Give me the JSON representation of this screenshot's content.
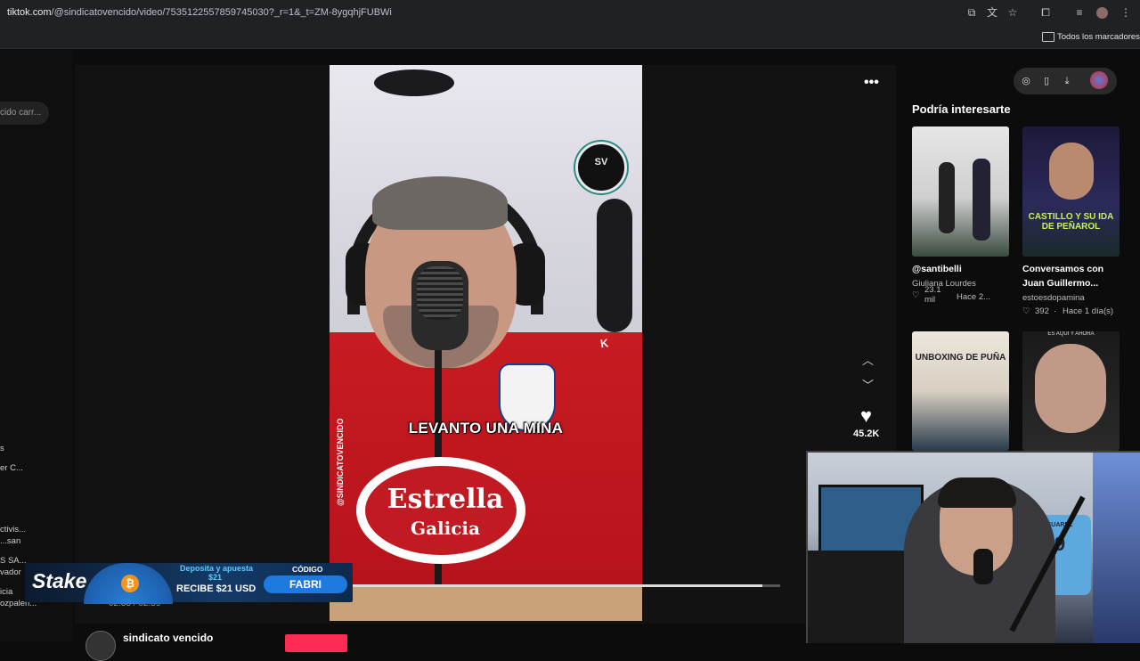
{
  "browser": {
    "url_host": "tiktok.com",
    "url_path": "/@sindicatovencido/video/7535122557859745030?_r=1&_t=ZM-8ygqhjFUBWi",
    "bookmarks_label": "Todos los marcadores"
  },
  "left_sidebar": {
    "search_text": "cido carr...",
    "items": [
      "s",
      "er C...",
      "ctivis...",
      "...san",
      "S SA...",
      "vador",
      "icia",
      "ozpalen..."
    ]
  },
  "video": {
    "overlay_caption": "LEVANTO UNA MINA",
    "watermark_handle": "@SINDICATOVENCIDO",
    "badge_text": "SV",
    "shirt_brand_1": "Estrella",
    "shirt_brand_2": "Galicia",
    "time": "02:33 / 02:59",
    "progress_fraction": 0.974
  },
  "actions": {
    "likes": "45.2K"
  },
  "account": {
    "name": "sindicato vencido"
  },
  "sidebar": {
    "title": "Podría interesarte",
    "recommendations": [
      {
        "title": "@santibelli",
        "author": "Giuliana Lourdes",
        "likes": "23.1 mil",
        "age": "Hace 2..."
      },
      {
        "title": "Conversamos con",
        "title2": "Juan Guillermo...",
        "author": "estoesdopamina",
        "likes": "392",
        "age": "Hace 1 día(s)",
        "thumb_text": "CASTILLO Y SU IDA DE PEÑAROL"
      },
      {
        "thumb_text": "UNBOXING DE PUÑA"
      },
      {
        "thumb_text": "ES AQUÍ Y AHORA"
      }
    ]
  },
  "ad_banner": {
    "brand": "Stake",
    "line1": "Deposita y apuesta",
    "line1b": "$21",
    "line2": "RECIBE $21 USD",
    "code_label": "CÓDIGO",
    "code": "FABRI"
  },
  "webcam": {
    "jersey_name": "SUAREZ",
    "jersey_number": "9"
  },
  "colors": {
    "follow_button": "#fe2c55",
    "shirt_red": "#c81b22",
    "banner_blue": "#1f7ae0"
  },
  "icons": [
    "cast-icon",
    "translate-icon",
    "star-icon",
    "extensions-icon",
    "menu-icon",
    "profile-icon",
    "kebab-icon",
    "folder-icon",
    "more-icon",
    "arrow-up-icon",
    "arrow-down-icon",
    "heart-icon",
    "compass-icon",
    "phone-icon",
    "download-icon"
  ]
}
